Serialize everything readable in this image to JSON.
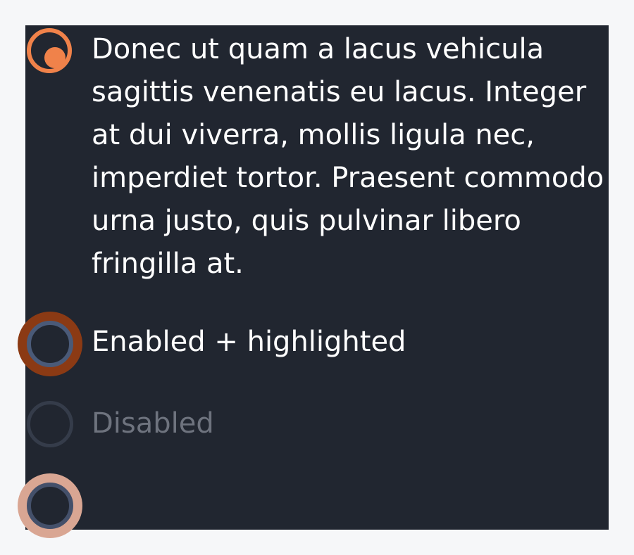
{
  "colors": {
    "page_background": "#f6f7f9",
    "panel_background": "#212630",
    "accent": "#f0824a",
    "highlight_halo": "#8b3a14",
    "hover_halo": "#d9a693",
    "radio_border": "#4a5a78",
    "text": "#ffffff",
    "disabled_text": "#6e737e"
  },
  "radios": [
    {
      "state": "checked",
      "lines": [
        "Donec ut quam a lacus vehicula",
        "sagittis venenatis eu lacus. Integer",
        "at dui viverra, mollis ligula nec,",
        "imperdiet tortor. Praesent commodo",
        "urna justo, quis pulvinar libero",
        "fringilla at."
      ]
    },
    {
      "state": "enabled-highlighted",
      "label": "Enabled + highlighted"
    },
    {
      "state": "disabled",
      "label": "Disabled"
    },
    {
      "state": "hovered",
      "label": ""
    }
  ]
}
